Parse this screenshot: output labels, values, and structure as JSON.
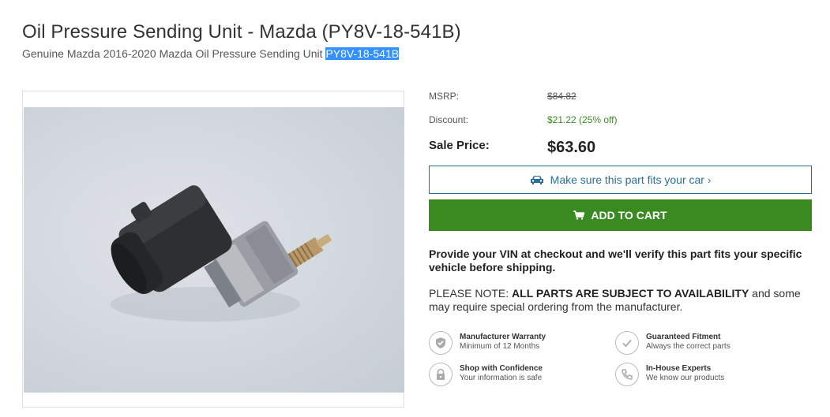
{
  "header": {
    "title": "Oil Pressure Sending Unit - Mazda (PY8V-18-541B)",
    "subtitle_prefix": "Genuine Mazda 2016-2020 Mazda Oil Pressure Sending Unit ",
    "subtitle_part": "PY8V-18-541B"
  },
  "pricing": {
    "msrp_label": "MSRP:",
    "msrp_value": "$84.82",
    "discount_label": "Discount:",
    "discount_value": "$21.22 (25% off)",
    "sale_label": "Sale Price:",
    "sale_value": "$63.60"
  },
  "buttons": {
    "fit_label": "Make sure this part fits your car",
    "fit_chevron": "›",
    "cart_label": "ADD TO CART"
  },
  "vin_text": "Provide your VIN at checkout and we'll verify this part fits your specific vehicle before shipping.",
  "note": {
    "prefix": "PLEASE NOTE: ",
    "bold": "ALL PARTS ARE SUBJECT TO AVAILABILITY",
    "suffix": " and some may require special ordering from the manufacturer."
  },
  "features": [
    {
      "icon": "shield-icon",
      "title": "Manufacturer Warranty",
      "sub": "Minimum of 12 Months"
    },
    {
      "icon": "check-icon",
      "title": "Guaranteed Fitment",
      "sub": "Always the correct parts"
    },
    {
      "icon": "lock-icon",
      "title": "Shop with Confidence",
      "sub": "Your information is safe"
    },
    {
      "icon": "phone-icon",
      "title": "In-House Experts",
      "sub": "We know our products"
    }
  ],
  "colors": {
    "accent_green": "#3a8a22",
    "link_blue": "#2a6f97",
    "selection_blue": "#3390ff"
  }
}
